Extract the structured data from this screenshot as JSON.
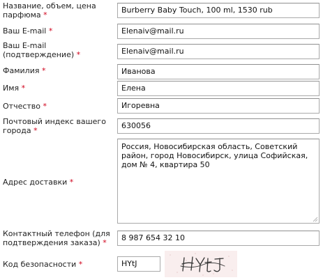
{
  "required_mark": "*",
  "form": {
    "fields": [
      {
        "label": "Название, объем, цена парфюма",
        "value": "Burberry Baby Touch, 100 ml, 1530 rub"
      },
      {
        "label": "Ваш E-mail",
        "value": "Elenaiv@mail.ru"
      },
      {
        "label": "Ваш E-mail (подтверждение)",
        "value": "Elenaiv@mail.ru"
      },
      {
        "label": "Фамилия",
        "value": "Иванова"
      },
      {
        "label": "Имя",
        "value": "Елена"
      },
      {
        "label": "Отчество",
        "value": "Игоревна"
      },
      {
        "label": "Почтовый индекс вашего города",
        "value": "630056"
      },
      {
        "label": "Адрес доставки",
        "value": "Россия, Новосибирская область, Советский район, город Новосибирск, улица Софийская, дом № 4, квартира 50"
      },
      {
        "label": "Контактный телефон (для подтверждения заказа)",
        "value": "8 987 654 32 10"
      },
      {
        "label": "Код безопасности",
        "value": "HYtJ"
      }
    ],
    "captcha_text": "HYtJ"
  }
}
